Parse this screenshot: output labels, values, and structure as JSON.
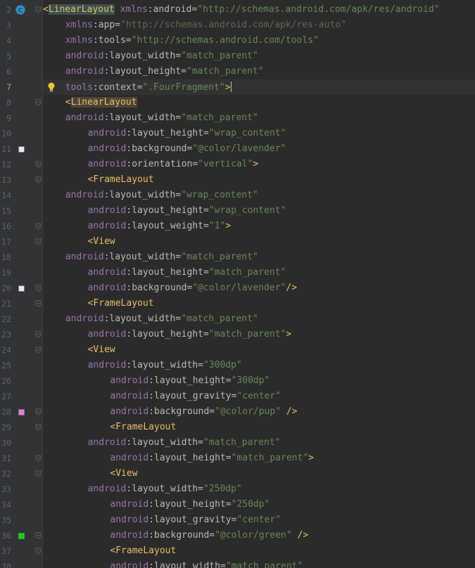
{
  "editor": {
    "file_type": "xml",
    "current_line": 7,
    "lines": [
      {
        "no": "2",
        "code": "<LinearLayout xmlns:android=\"http://schemas.android.com/apk/res/android\""
      },
      {
        "no": "3",
        "code": "xmlns:app=\"http://schemas.android.com/apk/res-auto\""
      },
      {
        "no": "4",
        "code": "xmlns:tools=\"http://schemas.android.com/tools\""
      },
      {
        "no": "5",
        "code": "android:layout_width=\"match_parent\""
      },
      {
        "no": "6",
        "code": "android:layout_height=\"match_parent\""
      },
      {
        "no": "7",
        "code": "tools:context=\".FourFragment\">"
      },
      {
        "no": "8",
        "code": "<LinearLayout"
      },
      {
        "no": "9",
        "code": "android:layout_width=\"match_parent\""
      },
      {
        "no": "10",
        "code": "android:layout_height=\"wrap_content\""
      },
      {
        "no": "11",
        "code": "android:background=\"@color/lavender\""
      },
      {
        "no": "12",
        "code": "android:orientation=\"vertical\">"
      },
      {
        "no": "13",
        "code": "<FrameLayout"
      },
      {
        "no": "14",
        "code": "android:layout_width=\"wrap_content\""
      },
      {
        "no": "15",
        "code": "android:layout_height=\"wrap_content\""
      },
      {
        "no": "16",
        "code": "android:layout_weight=\"1\">"
      },
      {
        "no": "17",
        "code": "<View"
      },
      {
        "no": "18",
        "code": "android:layout_width=\"match_parent\""
      },
      {
        "no": "19",
        "code": "android:layout_height=\"match_parent\""
      },
      {
        "no": "20",
        "code": "android:background=\"@color/lavender\"/>"
      },
      {
        "no": "21",
        "code": "<FrameLayout"
      },
      {
        "no": "22",
        "code": "android:layout_width=\"match_parent\""
      },
      {
        "no": "23",
        "code": "android:layout_height=\"match_parent\">"
      },
      {
        "no": "24",
        "code": "<View"
      },
      {
        "no": "25",
        "code": "android:layout_width=\"300dp\""
      },
      {
        "no": "26",
        "code": "android:layout_height=\"300dp\""
      },
      {
        "no": "27",
        "code": "android:layout_gravity=\"center\""
      },
      {
        "no": "28",
        "code": "android:background=\"@color/pup\" />"
      },
      {
        "no": "29",
        "code": "<FrameLayout"
      },
      {
        "no": "30",
        "code": "android:layout_width=\"match_parent\""
      },
      {
        "no": "31",
        "code": "android:layout_height=\"match_parent\">"
      },
      {
        "no": "32",
        "code": "<View"
      },
      {
        "no": "33",
        "code": "android:layout_width=\"250dp\""
      },
      {
        "no": "34",
        "code": "android:layout_height=\"250dp\""
      },
      {
        "no": "35",
        "code": "android:layout_gravity=\"center\""
      },
      {
        "no": "36",
        "code": "android:background=\"@color/green\" />"
      },
      {
        "no": "37",
        "code": "<FrameLayout"
      },
      {
        "no": "38",
        "code": "android:layout_width=\"match_parent\""
      }
    ]
  },
  "gutter": {
    "class_badge_letter": "C",
    "color_swatches": {
      "11": "#e6e6fa",
      "20": "#e6e6fa",
      "28": "#e57ee0",
      "36": "#00e000"
    }
  },
  "theme": {
    "background": "#2b2b2b",
    "gutter": "#313335",
    "tag": "#e8bf6a",
    "namespace": "#9876aa",
    "attribute": "#bababa",
    "value": "#6a8759"
  }
}
